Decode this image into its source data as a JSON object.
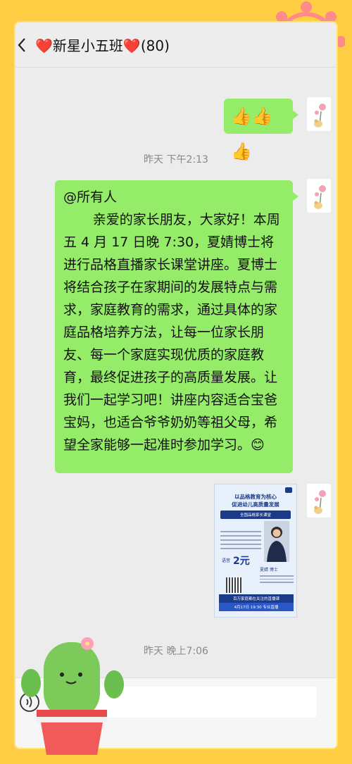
{
  "header": {
    "back_icon": "chevron-left-icon",
    "title": "❤️新星小五班❤️(80)",
    "title_text": "新星小五班",
    "member_count": "(80)"
  },
  "messages": [
    {
      "type": "emoji",
      "content": "👍👍👍"
    },
    {
      "type": "timestamp",
      "content": "昨天 下午2:13"
    },
    {
      "type": "text",
      "mention": "@所有人",
      "body": "亲爱的家长朋友，大家好！本周五 4 月 17 日晚 7:30，夏婧博士将进行品格直播家长课堂讲座。夏博士将结合孩子在家期间的发展特点与需求，家庭教育的需求，通过具体的家庭品格培养方法，让每一位家长朋友、每一个家庭实现优质的家庭教育，最终促进孩子的高质量发展。让我们一起学习吧！讲座内容适合宝爸宝妈，也适合爷爷奶奶等祖父母，希望全家能够一起准时参加学习。😊"
    },
    {
      "type": "image",
      "poster": {
        "headline1": "以品格教育为核心",
        "headline2": "促进幼儿高质量发展",
        "tag": "全国品格家长课堂",
        "speaker": "夏婧 博士",
        "price_label": "语音",
        "price": "2元",
        "bottom1": "百万家庭都在关注的直播课",
        "bottom2": "4月17日 19:30 专业直播"
      }
    },
    {
      "type": "timestamp",
      "content": "昨天 晚上7:06"
    }
  ],
  "colors": {
    "background": "#FFCE45",
    "bubble": "#95EC69",
    "chat_bg": "#ECECEC"
  }
}
